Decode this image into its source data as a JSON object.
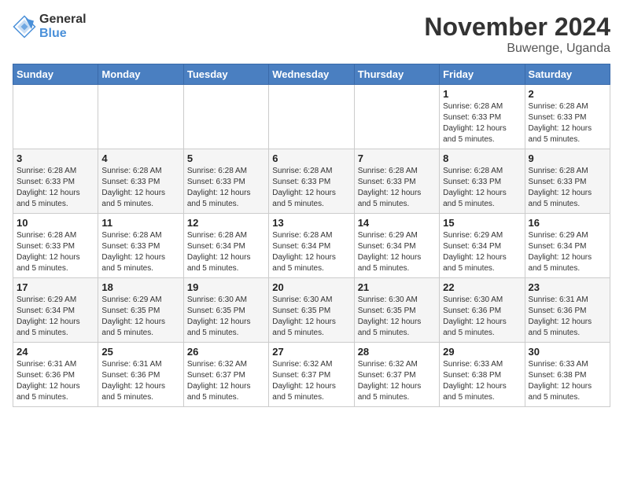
{
  "logo": {
    "general": "General",
    "blue": "Blue"
  },
  "title": "November 2024",
  "location": "Buwenge, Uganda",
  "days_of_week": [
    "Sunday",
    "Monday",
    "Tuesday",
    "Wednesday",
    "Thursday",
    "Friday",
    "Saturday"
  ],
  "weeks": [
    [
      {
        "day": "",
        "info": ""
      },
      {
        "day": "",
        "info": ""
      },
      {
        "day": "",
        "info": ""
      },
      {
        "day": "",
        "info": ""
      },
      {
        "day": "",
        "info": ""
      },
      {
        "day": "1",
        "info": "Sunrise: 6:28 AM\nSunset: 6:33 PM\nDaylight: 12 hours and 5 minutes."
      },
      {
        "day": "2",
        "info": "Sunrise: 6:28 AM\nSunset: 6:33 PM\nDaylight: 12 hours and 5 minutes."
      }
    ],
    [
      {
        "day": "3",
        "info": "Sunrise: 6:28 AM\nSunset: 6:33 PM\nDaylight: 12 hours and 5 minutes."
      },
      {
        "day": "4",
        "info": "Sunrise: 6:28 AM\nSunset: 6:33 PM\nDaylight: 12 hours and 5 minutes."
      },
      {
        "day": "5",
        "info": "Sunrise: 6:28 AM\nSunset: 6:33 PM\nDaylight: 12 hours and 5 minutes."
      },
      {
        "day": "6",
        "info": "Sunrise: 6:28 AM\nSunset: 6:33 PM\nDaylight: 12 hours and 5 minutes."
      },
      {
        "day": "7",
        "info": "Sunrise: 6:28 AM\nSunset: 6:33 PM\nDaylight: 12 hours and 5 minutes."
      },
      {
        "day": "8",
        "info": "Sunrise: 6:28 AM\nSunset: 6:33 PM\nDaylight: 12 hours and 5 minutes."
      },
      {
        "day": "9",
        "info": "Sunrise: 6:28 AM\nSunset: 6:33 PM\nDaylight: 12 hours and 5 minutes."
      }
    ],
    [
      {
        "day": "10",
        "info": "Sunrise: 6:28 AM\nSunset: 6:33 PM\nDaylight: 12 hours and 5 minutes."
      },
      {
        "day": "11",
        "info": "Sunrise: 6:28 AM\nSunset: 6:33 PM\nDaylight: 12 hours and 5 minutes."
      },
      {
        "day": "12",
        "info": "Sunrise: 6:28 AM\nSunset: 6:34 PM\nDaylight: 12 hours and 5 minutes."
      },
      {
        "day": "13",
        "info": "Sunrise: 6:28 AM\nSunset: 6:34 PM\nDaylight: 12 hours and 5 minutes."
      },
      {
        "day": "14",
        "info": "Sunrise: 6:29 AM\nSunset: 6:34 PM\nDaylight: 12 hours and 5 minutes."
      },
      {
        "day": "15",
        "info": "Sunrise: 6:29 AM\nSunset: 6:34 PM\nDaylight: 12 hours and 5 minutes."
      },
      {
        "day": "16",
        "info": "Sunrise: 6:29 AM\nSunset: 6:34 PM\nDaylight: 12 hours and 5 minutes."
      }
    ],
    [
      {
        "day": "17",
        "info": "Sunrise: 6:29 AM\nSunset: 6:34 PM\nDaylight: 12 hours and 5 minutes."
      },
      {
        "day": "18",
        "info": "Sunrise: 6:29 AM\nSunset: 6:35 PM\nDaylight: 12 hours and 5 minutes."
      },
      {
        "day": "19",
        "info": "Sunrise: 6:30 AM\nSunset: 6:35 PM\nDaylight: 12 hours and 5 minutes."
      },
      {
        "day": "20",
        "info": "Sunrise: 6:30 AM\nSunset: 6:35 PM\nDaylight: 12 hours and 5 minutes."
      },
      {
        "day": "21",
        "info": "Sunrise: 6:30 AM\nSunset: 6:35 PM\nDaylight: 12 hours and 5 minutes."
      },
      {
        "day": "22",
        "info": "Sunrise: 6:30 AM\nSunset: 6:36 PM\nDaylight: 12 hours and 5 minutes."
      },
      {
        "day": "23",
        "info": "Sunrise: 6:31 AM\nSunset: 6:36 PM\nDaylight: 12 hours and 5 minutes."
      }
    ],
    [
      {
        "day": "24",
        "info": "Sunrise: 6:31 AM\nSunset: 6:36 PM\nDaylight: 12 hours and 5 minutes."
      },
      {
        "day": "25",
        "info": "Sunrise: 6:31 AM\nSunset: 6:36 PM\nDaylight: 12 hours and 5 minutes."
      },
      {
        "day": "26",
        "info": "Sunrise: 6:32 AM\nSunset: 6:37 PM\nDaylight: 12 hours and 5 minutes."
      },
      {
        "day": "27",
        "info": "Sunrise: 6:32 AM\nSunset: 6:37 PM\nDaylight: 12 hours and 5 minutes."
      },
      {
        "day": "28",
        "info": "Sunrise: 6:32 AM\nSunset: 6:37 PM\nDaylight: 12 hours and 5 minutes."
      },
      {
        "day": "29",
        "info": "Sunrise: 6:33 AM\nSunset: 6:38 PM\nDaylight: 12 hours and 5 minutes."
      },
      {
        "day": "30",
        "info": "Sunrise: 6:33 AM\nSunset: 6:38 PM\nDaylight: 12 hours and 5 minutes."
      }
    ]
  ]
}
